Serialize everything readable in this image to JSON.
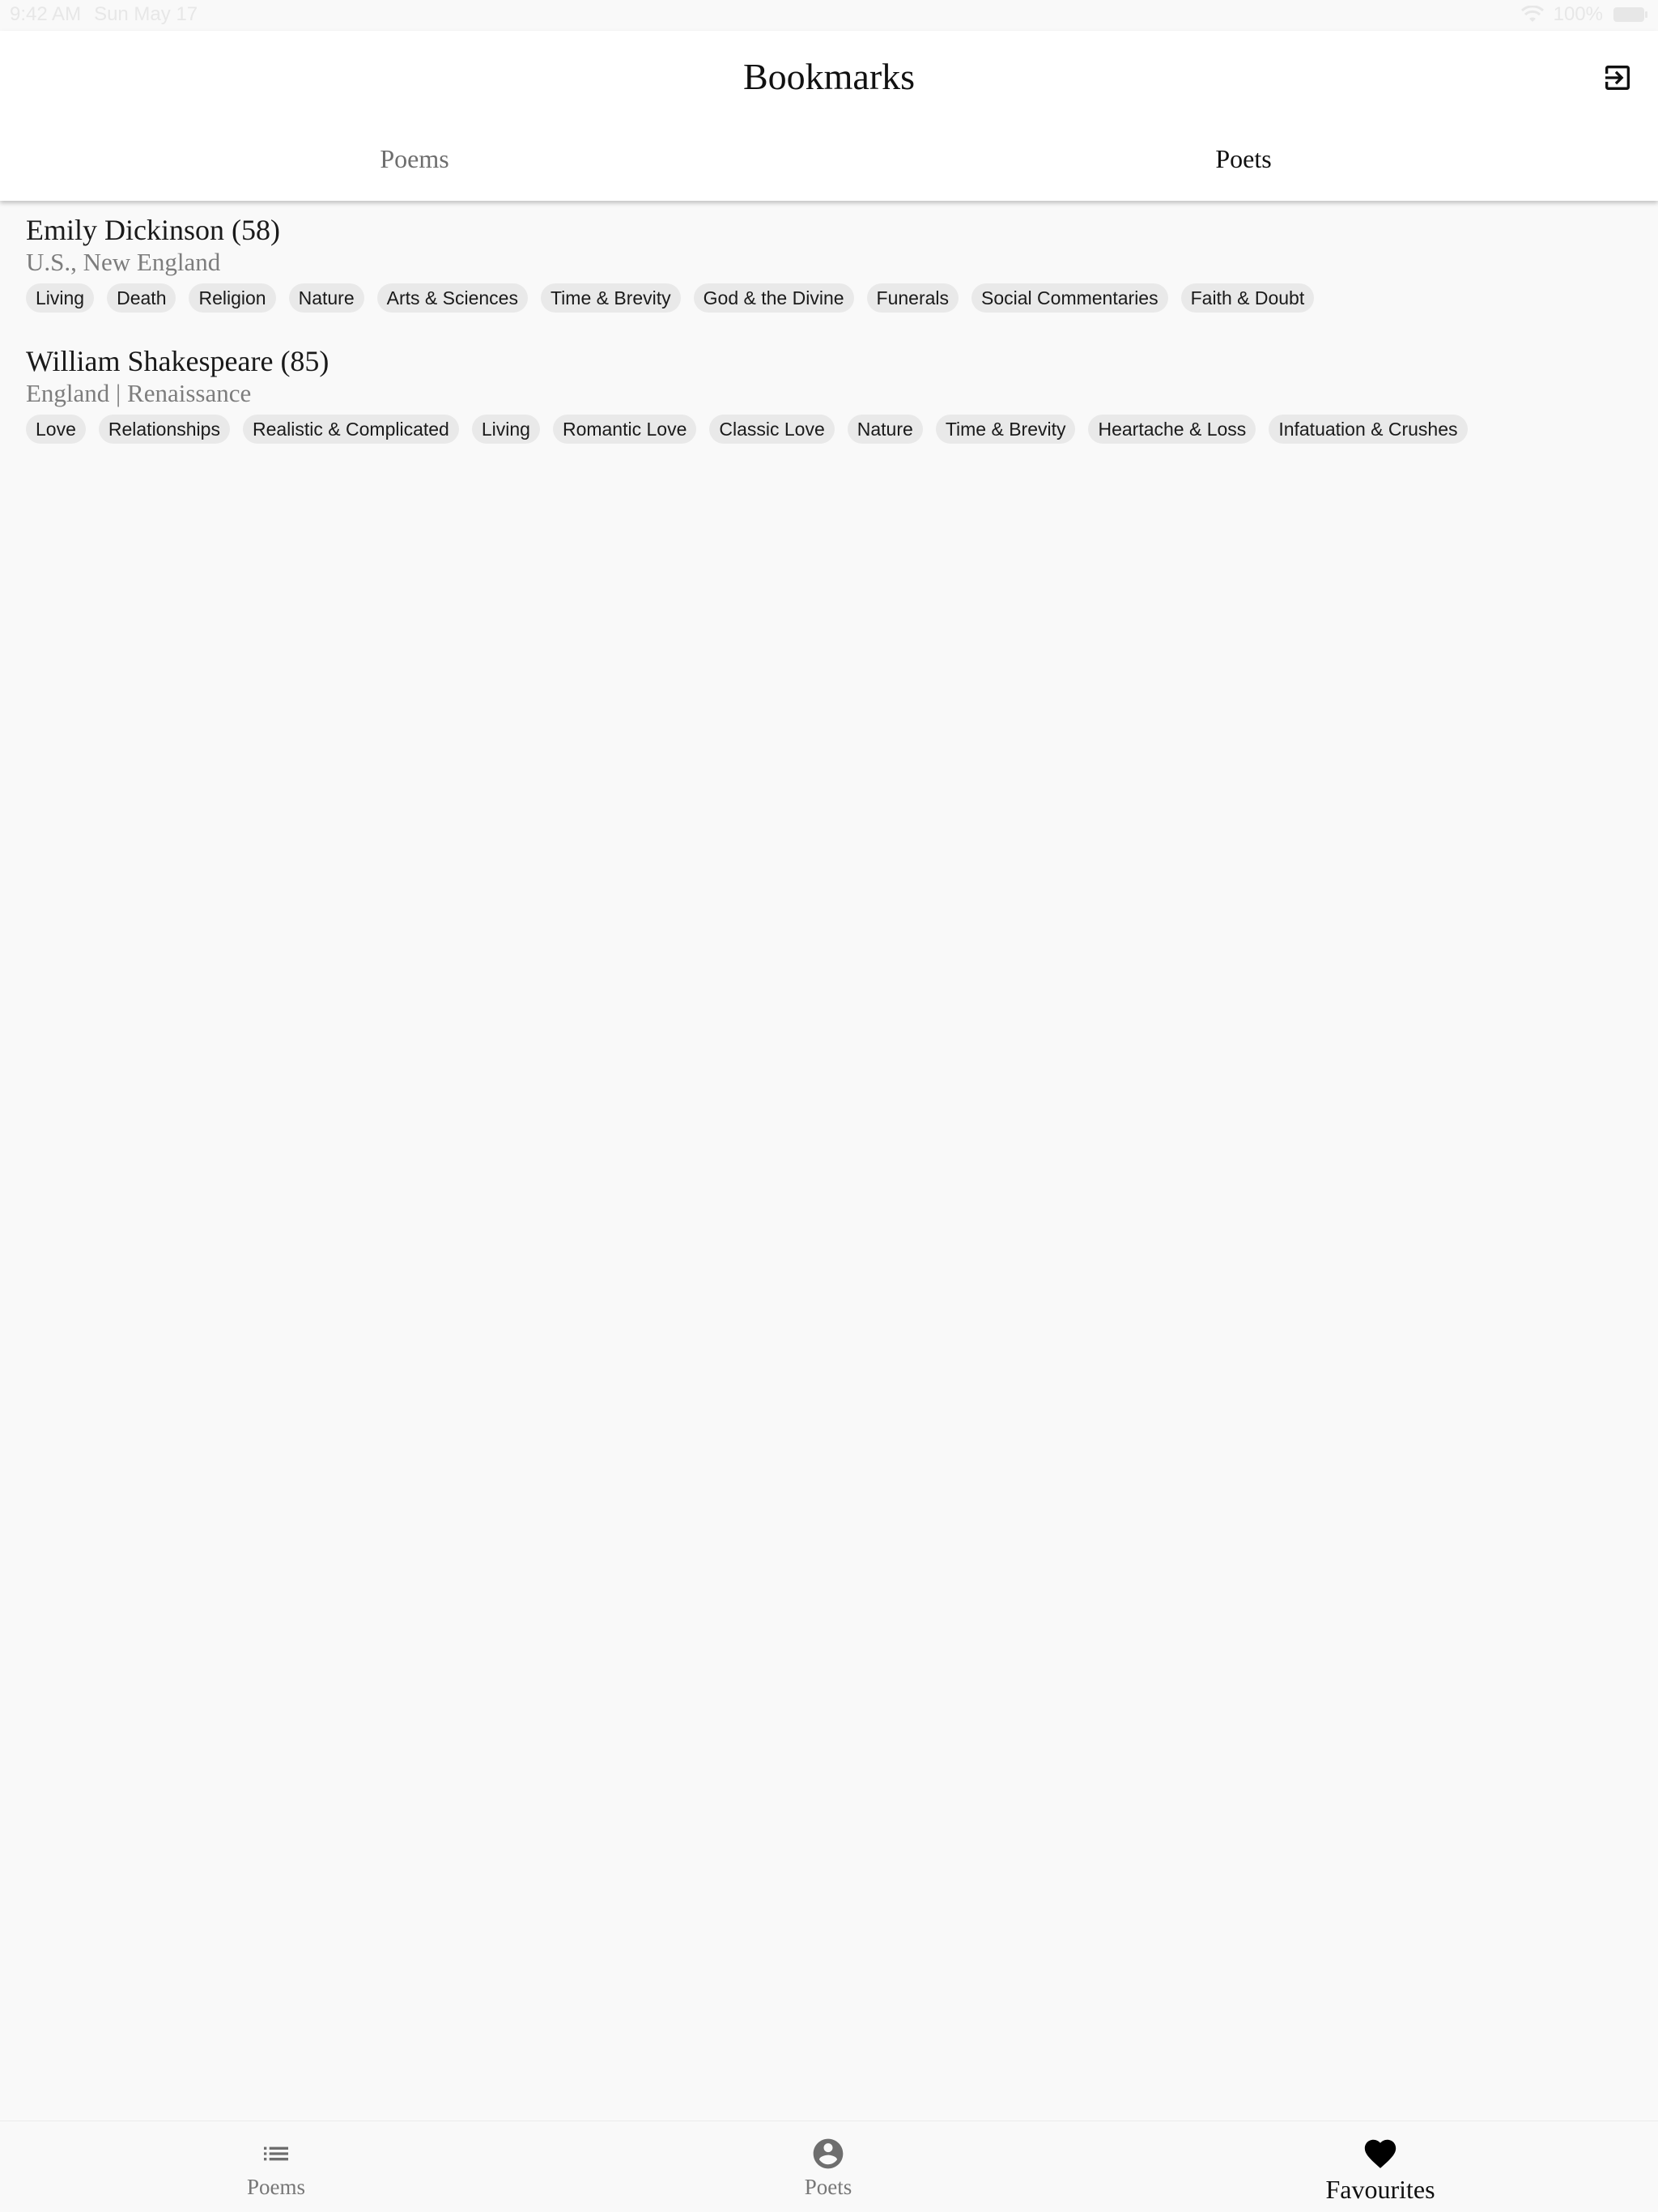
{
  "status_bar": {
    "time": "9:42 AM",
    "date": "Sun May 17",
    "battery": "100%"
  },
  "header": {
    "title": "Bookmarks",
    "exit_icon": "exit-to-app-icon",
    "tabs": [
      {
        "label": "Poems",
        "active": false
      },
      {
        "label": "Poets",
        "active": true
      }
    ]
  },
  "poets": [
    {
      "name": "Emily Dickinson (58)",
      "subtitle": "U.S., New England",
      "tags": [
        "Living",
        "Death",
        "Religion",
        "Nature",
        "Arts & Sciences",
        "Time & Brevity",
        "God & the Divine",
        "Funerals",
        "Social Commentaries",
        "Faith & Doubt"
      ]
    },
    {
      "name": "William Shakespeare (85)",
      "subtitle": "England | Renaissance",
      "tags": [
        "Love",
        "Relationships",
        "Realistic & Complicated",
        "Living",
        "Romantic Love",
        "Classic Love",
        "Nature",
        "Time & Brevity",
        "Heartache & Loss",
        "Infatuation & Crushes"
      ]
    }
  ],
  "bottom_nav": [
    {
      "label": "Poems",
      "icon": "list-icon",
      "active": false
    },
    {
      "label": "Poets",
      "icon": "account-circle-icon",
      "active": false
    },
    {
      "label": "Favourites",
      "icon": "heart-icon",
      "active": true
    }
  ],
  "colors": {
    "background": "#f9f9f9",
    "header": "#ffffff",
    "tag_bg": "#e9e9e9",
    "muted": "#7d7d7d"
  }
}
